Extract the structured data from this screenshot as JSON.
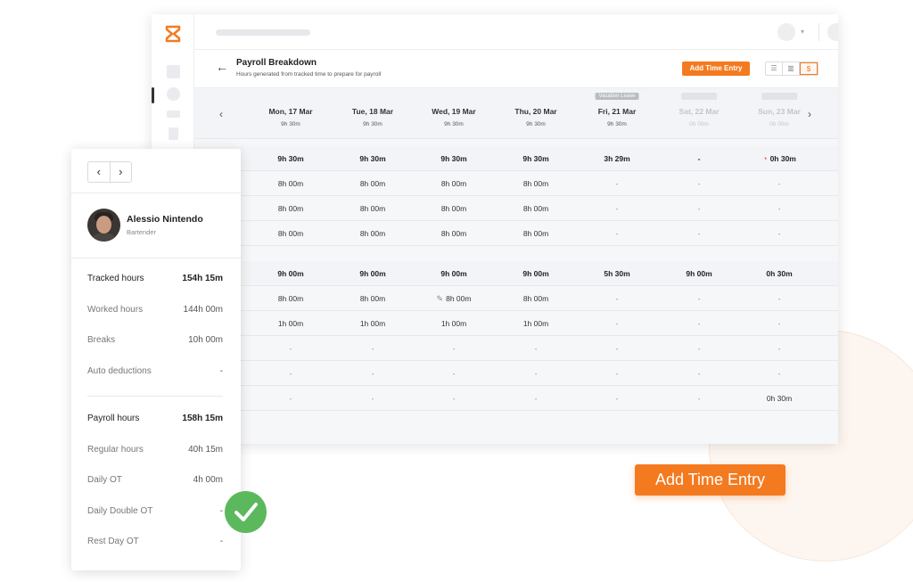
{
  "header": {
    "title": "Payroll Breakdown",
    "subtitle": "Hours generated from tracked time to prepare for payroll",
    "back_arrow": "←",
    "add_time_entry": "Add Time Entry",
    "view_toggle": [
      "☰",
      "▥",
      "$"
    ]
  },
  "days": [
    {
      "name": "Mon, 17 Mar",
      "hours": "9h 30m",
      "badge": ""
    },
    {
      "name": "Tue, 18 Mar",
      "hours": "9h 30m",
      "badge": ""
    },
    {
      "name": "Wed, 19 Mar",
      "hours": "9h 30m",
      "badge": ""
    },
    {
      "name": "Thu, 20 Mar",
      "hours": "9h 30m",
      "badge": ""
    },
    {
      "name": "Fri, 21 Mar",
      "hours": "9h 30m",
      "badge": "Vacation Leave"
    },
    {
      "name": "Sat, 22 Mar",
      "hours": "0h 00m",
      "badge": ""
    },
    {
      "name": "Sun, 23 Mar",
      "hours": "0h 00m",
      "badge": ""
    }
  ],
  "nav": {
    "prev": "‹",
    "next": "›"
  },
  "rows": [
    [
      "9h 30m",
      "9h 30m",
      "9h 30m",
      "9h 30m",
      "3h 29m",
      "-",
      "0h 30m"
    ],
    [
      "8h 00m",
      "8h 00m",
      "8h 00m",
      "8h 00m",
      "-",
      "-",
      "-"
    ],
    [
      "8h 00m",
      "8h 00m",
      "8h 00m",
      "8h 00m",
      "-",
      "-",
      "-"
    ],
    [
      "8h 00m",
      "8h 00m",
      "8h 00m",
      "8h 00m",
      "-",
      "-",
      "-"
    ],
    [
      "9h 00m",
      "9h 00m",
      "9h 00m",
      "9h 00m",
      "5h 30m",
      "9h 00m",
      "0h 30m"
    ],
    [
      "8h 00m",
      "8h 00m",
      "8h 00m",
      "8h 00m",
      "-",
      "-",
      "-"
    ],
    [
      "1h 00m",
      "1h 00m",
      "1h 00m",
      "1h 00m",
      "-",
      "-",
      "-"
    ],
    [
      "-",
      "-",
      "-",
      "-",
      "-",
      "-",
      "-"
    ],
    [
      "-",
      "-",
      "-",
      "-",
      "-",
      "-",
      "-"
    ],
    [
      "-",
      "-",
      "-",
      "-",
      "-",
      "-",
      "0h 30m"
    ]
  ],
  "employee": {
    "name": "Alessio Nintendo",
    "role": "Bartender",
    "pager_prev": "‹",
    "pager_next": "›"
  },
  "stats": [
    {
      "label": "Tracked hours",
      "value": "154h 15m"
    },
    {
      "label": "Worked hours",
      "value": "144h 00m"
    },
    {
      "label": "Breaks",
      "value": "10h 00m"
    },
    {
      "label": "Auto deductions",
      "value": "-"
    },
    {
      "label": "Payroll hours",
      "value": "158h 15m"
    },
    {
      "label": "Regular hours",
      "value": "40h 15m"
    },
    {
      "label": "Daily OT",
      "value": "4h 00m"
    },
    {
      "label": "Daily Double OT",
      "value": "-"
    },
    {
      "label": "Rest Day OT",
      "value": "-"
    }
  ],
  "cta": {
    "add_time_entry": "Add Time Entry"
  },
  "colors": {
    "accent": "#f47a20",
    "success": "#5cb85c"
  }
}
